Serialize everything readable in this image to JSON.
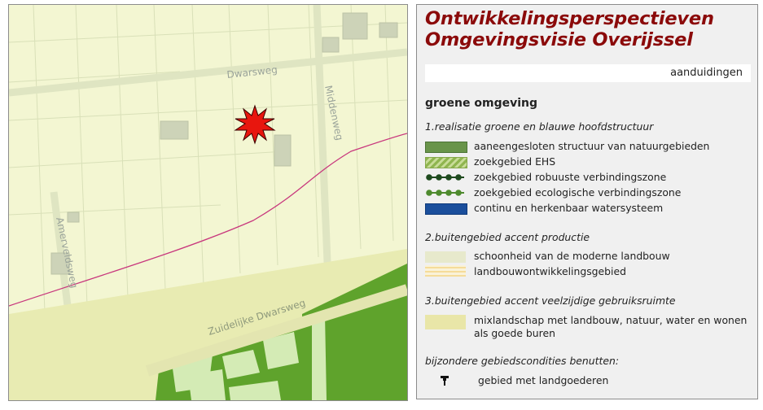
{
  "map": {
    "roads": [
      {
        "name": "Dwarsweg"
      },
      {
        "name": "Middenweg"
      },
      {
        "name": "Amerveldsweg"
      },
      {
        "name": "Zuidelijke Dwarsweg"
      }
    ],
    "colors": {
      "background": "#f3f6d2",
      "nature": "#68a630",
      "nature_light": "#7dbb40",
      "pale_green": "#d6ecb5",
      "boundary": "#c8377d",
      "marker": "#e8160e"
    },
    "icons": [
      "location-marker-icon"
    ]
  },
  "legend": {
    "title_line1": "Ontwikkelingsperspectieven",
    "title_line2": "Omgevingsvisie Overijssel",
    "tab_label": "aanduidingen",
    "section_title": "groene omgeving",
    "group1": {
      "title": "1.realisatie groene en blauwe hoofdstructuur",
      "items": [
        {
          "label": "aaneengesloten structuur van natuurgebieden",
          "color": "#69944a"
        },
        {
          "label": "zoekgebied EHS",
          "color": "#a8c46a"
        },
        {
          "label": "zoekgebied robuuste verbindingszone",
          "color": "#1e4a1e"
        },
        {
          "label": "zoekgebied ecologische verbindingszone",
          "color": "#4e8a2e"
        },
        {
          "label": "continu en herkenbaar watersysteem",
          "color": "#1b4f9c"
        }
      ]
    },
    "group2": {
      "title": "2.buitengebied accent productie",
      "items": [
        {
          "label": "schoonheid van de moderne landbouw",
          "color": "#eeeed4"
        },
        {
          "label": "landbouwontwikkelingsgebied",
          "color": "#f5dc9a"
        }
      ]
    },
    "group3": {
      "title": "3.buitengebied accent veelzijdige gebruiksruimte",
      "items": [
        {
          "label_line1": "mixlandschap met landbouw, natuur, water en wonen",
          "label_line2": "als goede buren",
          "color": "#e9e6a8"
        }
      ]
    },
    "group4": {
      "title": "bijzondere gebiedscondities benutten:",
      "items": [
        {
          "label": "gebied met landgoederen",
          "icon": "landgoed-icon"
        }
      ]
    }
  }
}
